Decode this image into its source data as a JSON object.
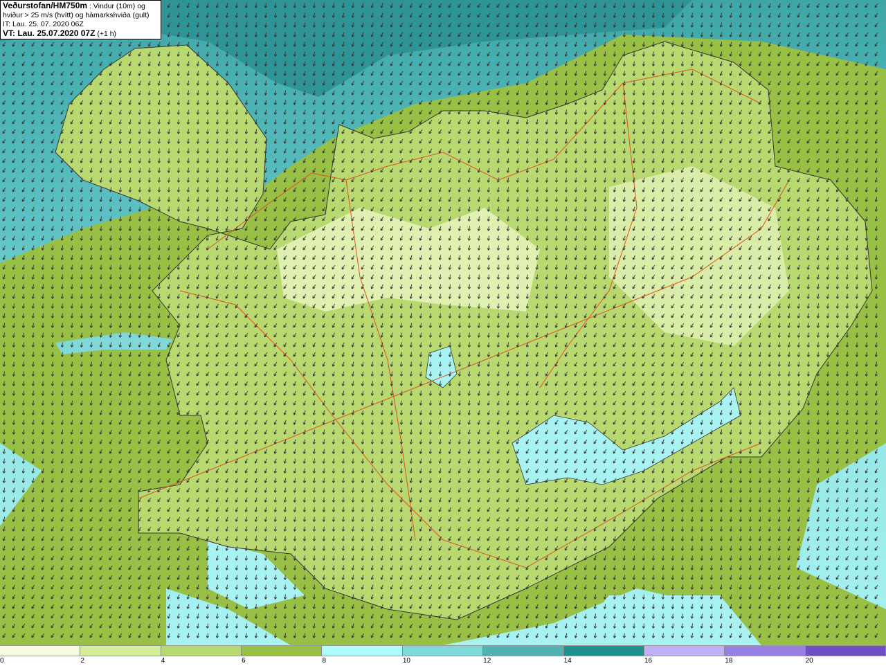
{
  "header": {
    "source": "Veðurstofan/HM750m",
    "description_line1": " : Vindur (10m) og",
    "description_line2": "hviður > 25 m/s (hvítt) og hámarkshviða (gult)",
    "initial_time": "IT: Lau. 25. 07. 2020 06Z",
    "valid_time": "VT: Lau. 25.07.2020 07Z",
    "lead_time": " (+1 h)"
  },
  "legend": {
    "ticks": [
      "0",
      "2",
      "4",
      "6",
      "8",
      "10",
      "12",
      "14",
      "16",
      "18",
      "20"
    ],
    "colors": [
      "#f4fbe0",
      "#d6ee98",
      "#b8d870",
      "#98c044",
      "#b0fcfc",
      "#80d8d8",
      "#50b2b2",
      "#209090",
      "#c0b0f8",
      "#9880e0",
      "#7050c0"
    ]
  },
  "map": {
    "sea_color_deep": "#3fa6a8",
    "sea_color_shallow": "#a8f2f2",
    "land_color": "#a8d068",
    "road_color": "#e05020",
    "wind_direction": "northeasterly"
  }
}
